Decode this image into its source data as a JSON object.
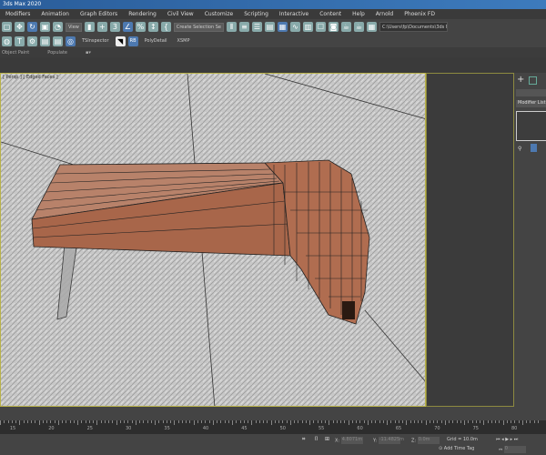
{
  "app": {
    "title": "3ds Max 2020"
  },
  "menu": [
    "Modifiers",
    "Animation",
    "Graph Editors",
    "Rendering",
    "Civil View",
    "Customize",
    "Scripting",
    "Interactive",
    "Content",
    "Help",
    "Arnold",
    "Phoenix FD"
  ],
  "toolbar": {
    "view_dropdown": "View",
    "selection_set": "Create Selection Se",
    "path": "C:\\Users\\fp\\Documents\\3ds Max"
  },
  "toolbar2": {
    "tsinspector": "TSInspector",
    "rb": "RB",
    "polydetail": "PolyDetail",
    "xsmp": "XSMP"
  },
  "ribbon": [
    "Object Paint",
    "Populate"
  ],
  "viewport": {
    "label": "[ Persp ] [ Edged Faces ]"
  },
  "command_panel": {
    "modifier_list": "Modifier List"
  },
  "timeline": {
    "ticks": [
      15,
      20,
      25,
      30,
      35,
      40,
      45,
      50,
      55,
      60,
      65,
      70,
      75,
      80
    ]
  },
  "status": {
    "x_label": "X:",
    "x": "4.8071m",
    "y_label": "Y:",
    "y": "-11.4825m",
    "z_label": "Z:",
    "z": "0.0m",
    "grid": "Grid = 10.0m",
    "add_time_tag": "Add Time Tag",
    "frame": "0"
  }
}
